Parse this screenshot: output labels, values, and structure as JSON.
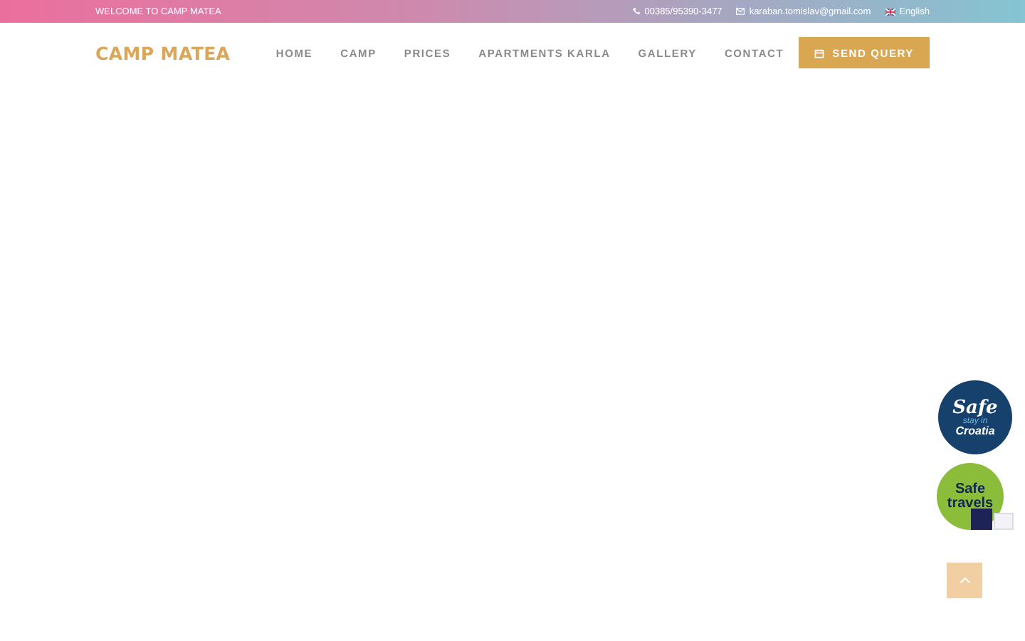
{
  "top_bar": {
    "welcome": "WELCOME TO CAMP MATEA",
    "phone": "00385/95390-3477",
    "email": "karaban.tomislav@gmail.com",
    "language": "English"
  },
  "header": {
    "logo": "CAMP MATEA",
    "nav": [
      {
        "label": "HOME"
      },
      {
        "label": "CAMP"
      },
      {
        "label": "PRICES"
      },
      {
        "label": "APARTMENTS KARLA"
      },
      {
        "label": "GALLERY"
      },
      {
        "label": "CONTACT"
      }
    ],
    "cta": "SEND QUERY"
  },
  "badges": [
    {
      "kind": "croatia",
      "line_1": "Safe",
      "line_2": "stay in",
      "line_3": "Croatia"
    },
    {
      "kind": "travels",
      "line_1": "Safe",
      "line_2": "travels"
    }
  ]
}
